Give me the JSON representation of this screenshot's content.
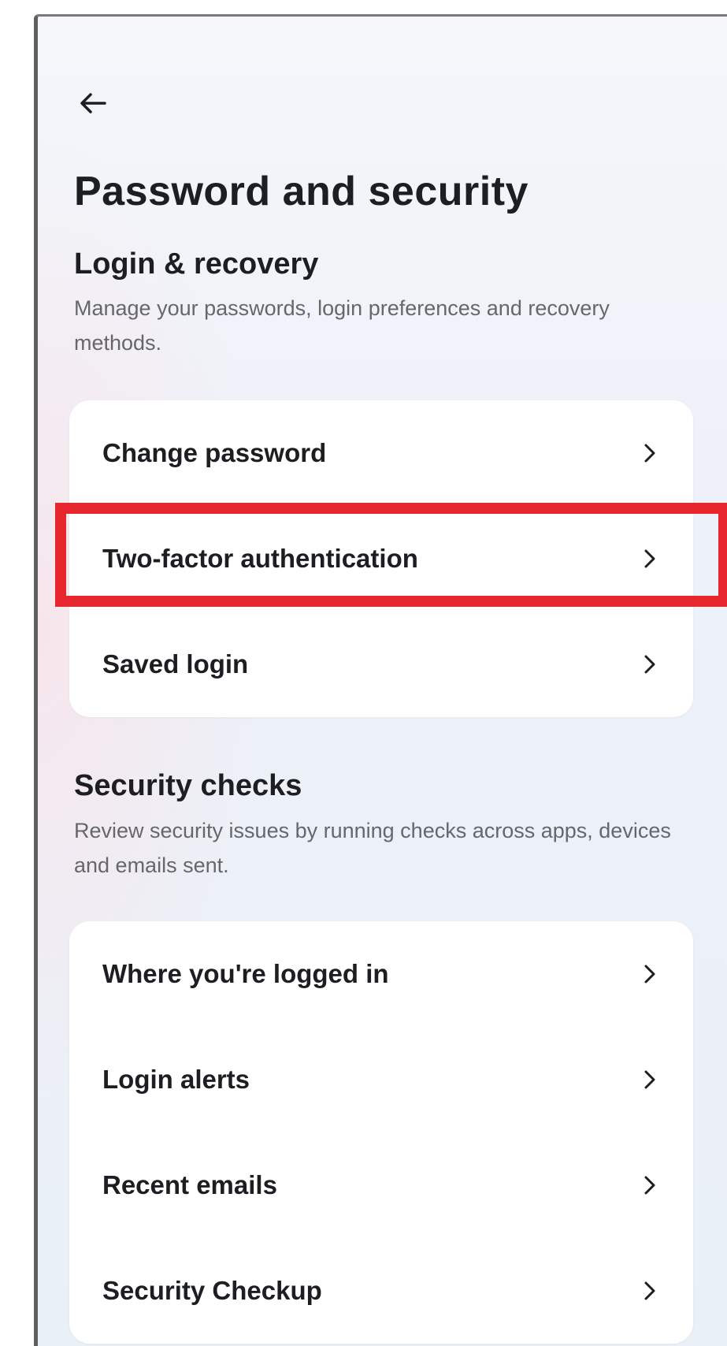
{
  "header": {
    "back_icon": "arrow-left-icon",
    "title": "Password and security"
  },
  "login_recovery": {
    "title": "Login & recovery",
    "description": "Manage your passwords, login preferences and recovery methods.",
    "items": [
      {
        "label": "Change password",
        "icon": "chevron-right-icon"
      },
      {
        "label": "Two-factor authentication",
        "icon": "chevron-right-icon",
        "highlighted": true
      },
      {
        "label": "Saved login",
        "icon": "chevron-right-icon"
      }
    ]
  },
  "security_checks": {
    "title": "Security checks",
    "description": "Review security issues by running checks across apps, devices and emails sent.",
    "items": [
      {
        "label": "Where you're logged in",
        "icon": "chevron-right-icon"
      },
      {
        "label": "Login alerts",
        "icon": "chevron-right-icon"
      },
      {
        "label": "Recent emails",
        "icon": "chevron-right-icon"
      },
      {
        "label": "Security Checkup",
        "icon": "chevron-right-icon"
      }
    ]
  },
  "colors": {
    "highlight": "#e8262d",
    "text_primary": "#1c1e21",
    "text_secondary": "#65676b",
    "card_background": "#ffffff"
  }
}
